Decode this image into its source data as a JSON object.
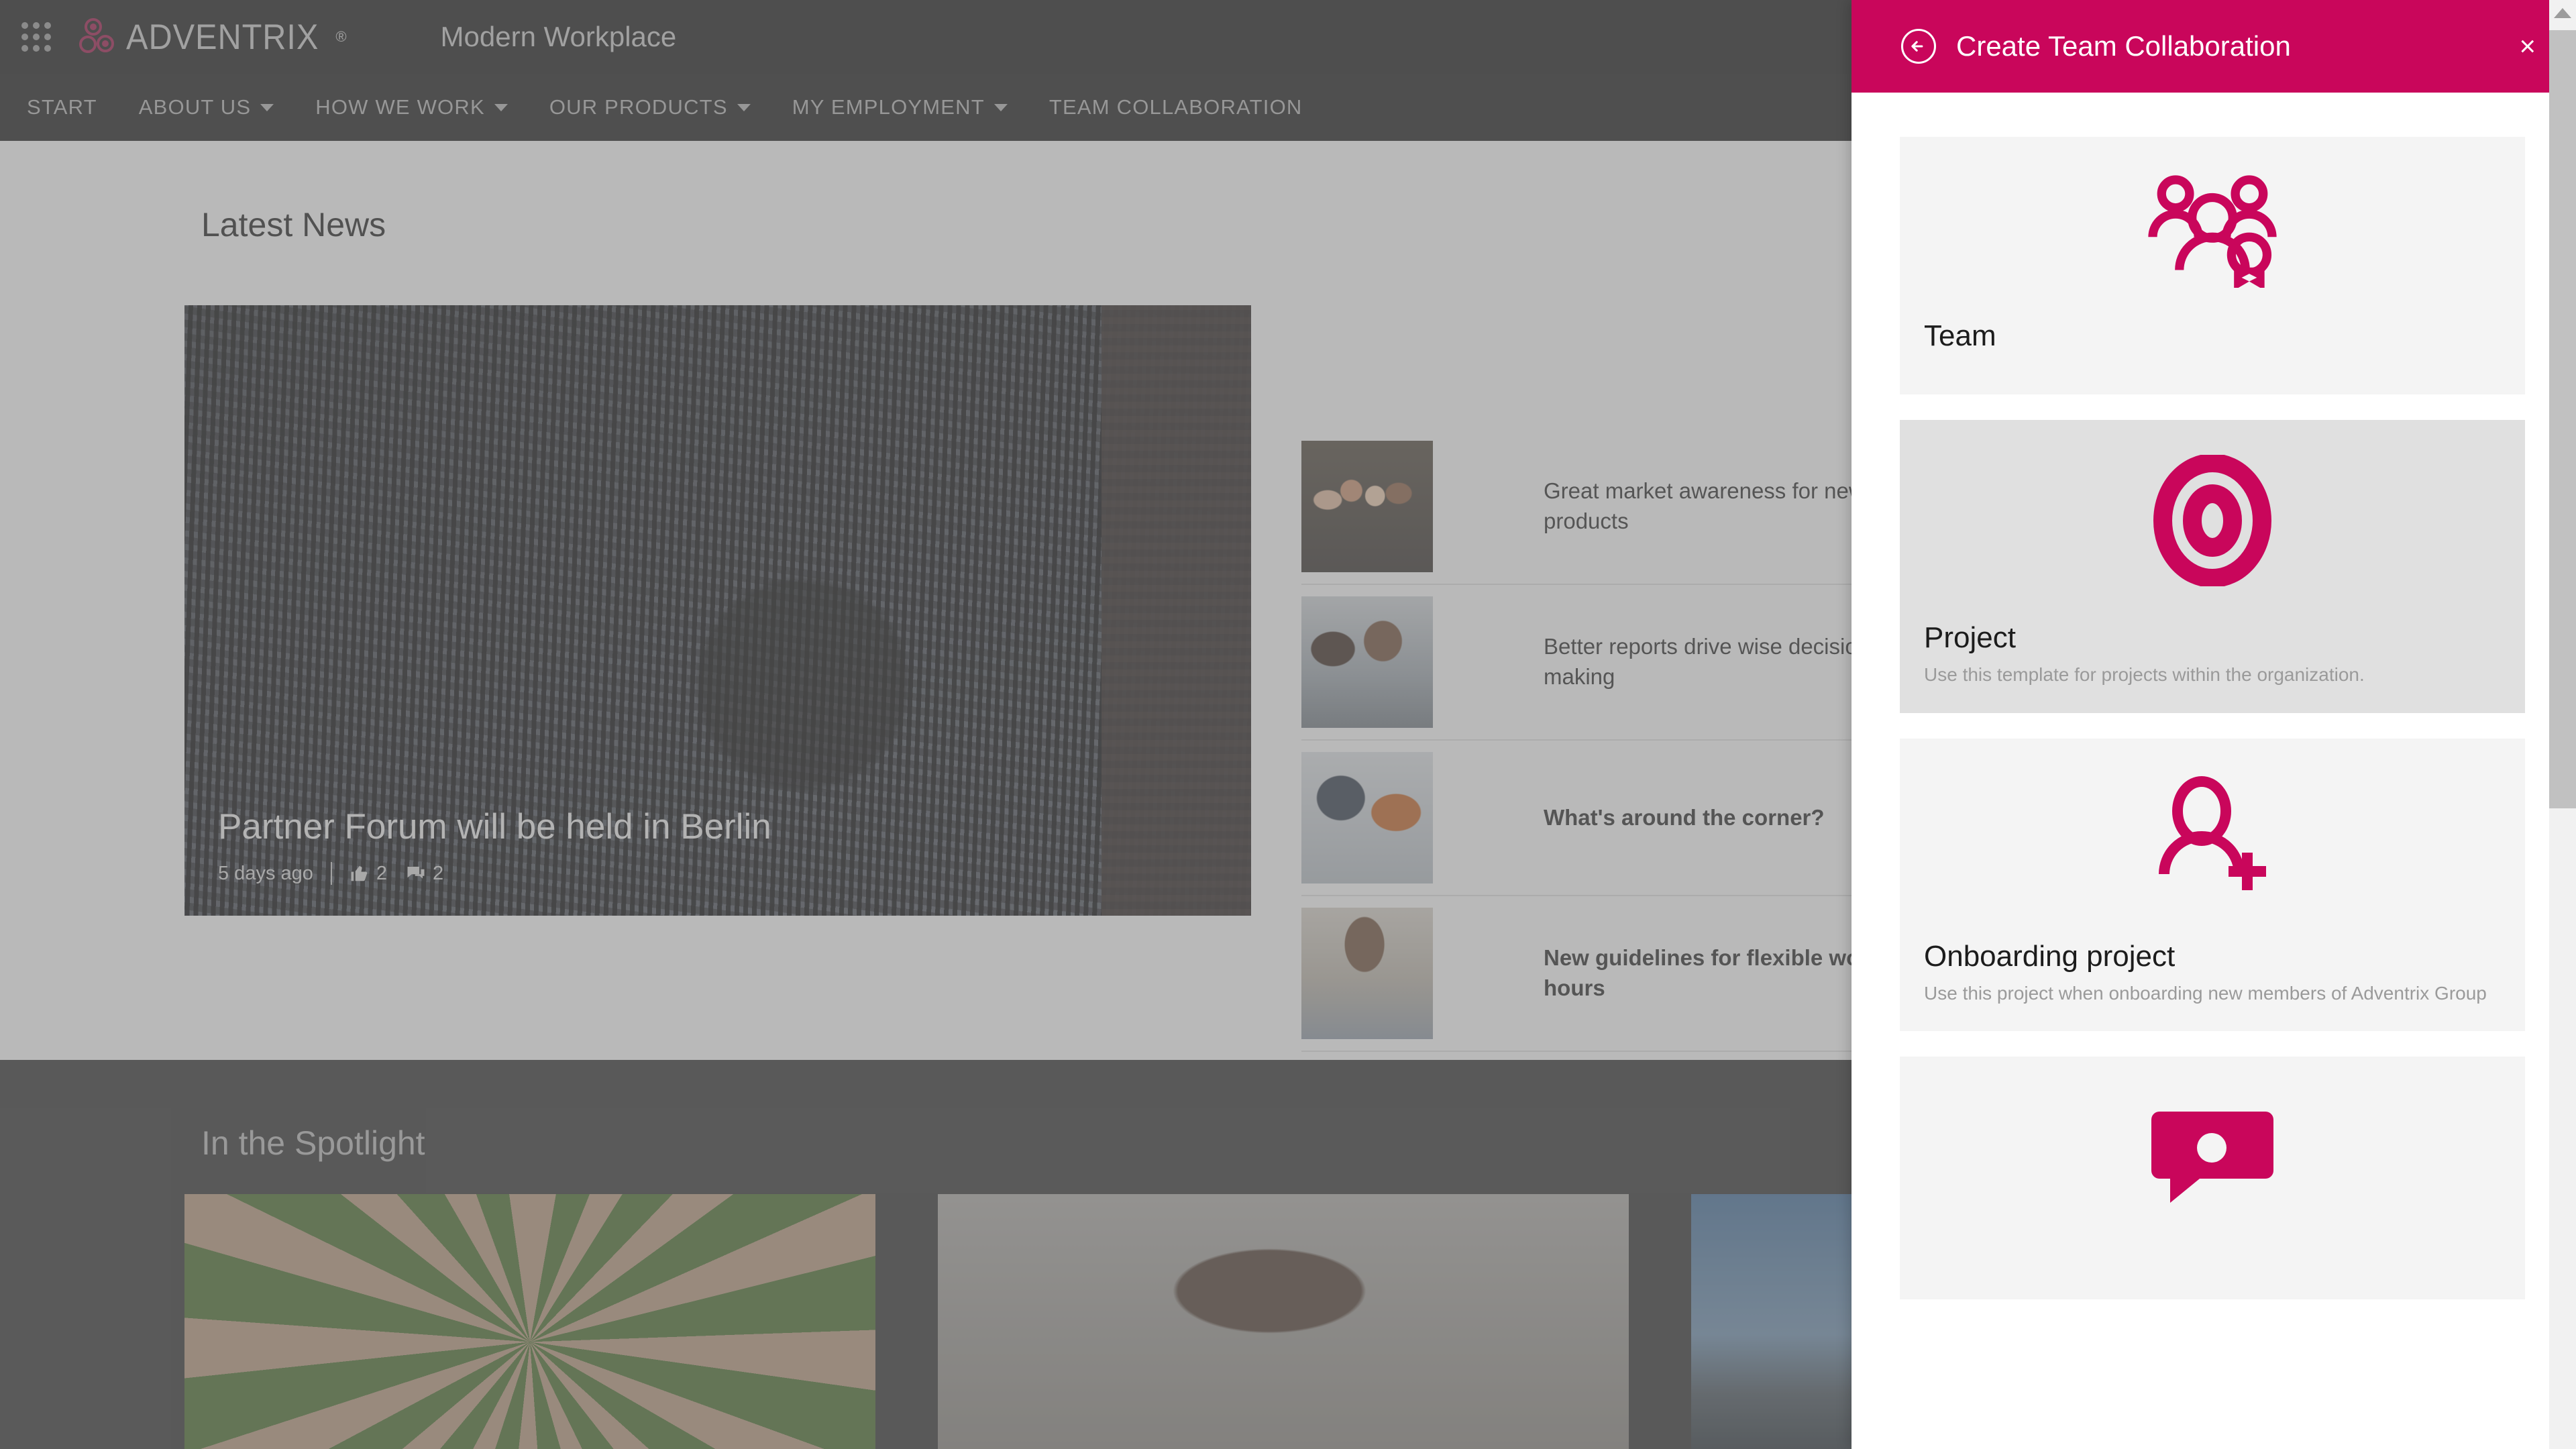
{
  "brand": {
    "logo_text": "ADVENTRIX",
    "logo_registered": "®",
    "app_subtitle": "Modern Workplace",
    "accent_color": "#c9065b",
    "topbar_color": "#121212",
    "apps_icon": "apps-grid-icon"
  },
  "nav": {
    "items": [
      {
        "label": "START",
        "has_caret": false
      },
      {
        "label": "ABOUT US",
        "has_caret": true
      },
      {
        "label": "HOW WE WORK",
        "has_caret": true
      },
      {
        "label": "OUR PRODUCTS",
        "has_caret": true
      },
      {
        "label": "MY EMPLOYMENT",
        "has_caret": true
      },
      {
        "label": "TEAM COLLABORATION",
        "has_caret": false
      }
    ]
  },
  "news": {
    "section_title": "Latest News",
    "hero": {
      "headline": "Partner Forum will be held in Berlin",
      "time_ago": "5 days ago",
      "likes": "2",
      "comments": "2",
      "like_icon": "thumbs-up-icon",
      "comment_icon": "comment-bubble-icon",
      "image_alt": "man-with-bicycle-in-front-of-street-art-mural"
    },
    "carousel": {
      "dot_count": 3,
      "active_index": 1
    },
    "list": [
      {
        "title": "Great market awareness for new products",
        "unread": false,
        "image_alt": "group-of-colleagues-portrait"
      },
      {
        "title": "Better reports drive wise decision-making",
        "unread": false,
        "image_alt": "two-women-talking-at-desk"
      },
      {
        "title": "What's around the corner?",
        "unread": true,
        "image_alt": "two-men-looking-at-laptop"
      },
      {
        "title": "New guidelines for flexible working hours",
        "unread": true,
        "image_alt": "man-holding-newspaper"
      }
    ]
  },
  "spotlight": {
    "section_title": "In the Spotlight",
    "cards": [
      {
        "image_alt": "hands-together-on-grass"
      },
      {
        "image_alt": "woman-with-glasses-at-laptop"
      },
      {
        "image_alt": "mountain-and-blue-sky"
      }
    ]
  },
  "panel": {
    "title": "Create Team Collaboration",
    "back_icon": "circle-arrow-left-icon",
    "close_icon": "close-icon",
    "close_label": "×",
    "header_color": "#c9065b",
    "templates": [
      {
        "name": "Team",
        "description": "",
        "icon": "three-people-with-badge-icon",
        "hovered": false
      },
      {
        "name": "Project",
        "description": "Use this template for projects within the organization.",
        "icon": "target-bullseye-icon",
        "hovered": true
      },
      {
        "name": "Onboarding project",
        "description": "Use this project when onboarding new members of Adventrix Group",
        "icon": "person-add-icon",
        "hovered": false
      },
      {
        "name": "",
        "description": "",
        "icon": "chat-bubble-icon",
        "hovered": false
      }
    ]
  },
  "scrollbar": {
    "up_arrow_icon": "scroll-up-arrow-icon",
    "thumb": "scrollbar-thumb"
  }
}
